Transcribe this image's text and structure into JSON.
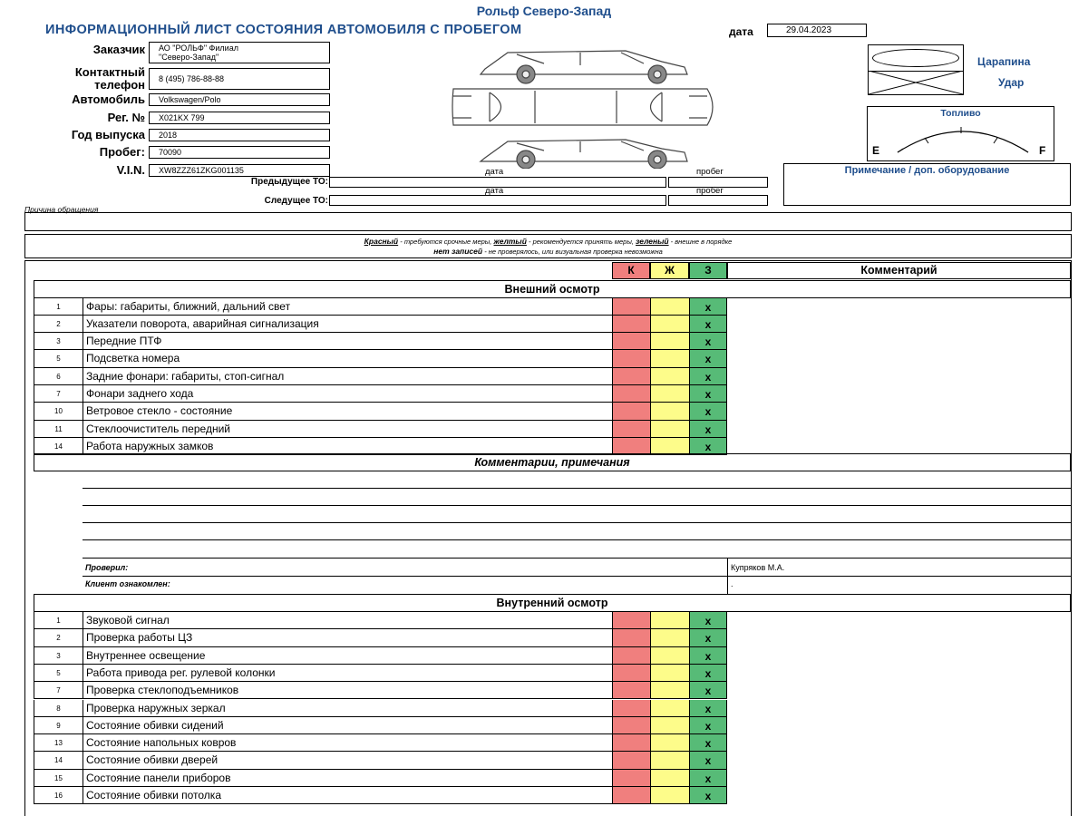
{
  "header": {
    "company": "Рольф Северо-Запад",
    "title": "ИНФОРМАЦИОННЫЙ ЛИСТ СОСТОЯНИЯ АВТОМОБИЛЯ С ПРОБЕГОМ",
    "date_label": "дата",
    "date_value": "29.04.2023"
  },
  "fields": {
    "customer_label": "Заказчик",
    "customer_value_line1": "АО \"РОЛЬФ\" Филиал",
    "customer_value_line2": "\"Северо-Запад\"",
    "phone_label_line1": "Контактный",
    "phone_label_line2": "телефон",
    "phone_value": "8 (495) 786-88-88",
    "car_label": "Автомобиль",
    "car_value": "Volkswagen/Polo",
    "reg_label": "Рег. №",
    "reg_value": "X021KX 799",
    "year_label": "Год выпуска",
    "year_value": "2018",
    "mileage_label": "Пробег:",
    "mileage_value": "70090",
    "vin_label": "V.I.N.",
    "vin_value": "XW8ZZZ61ZKG001135"
  },
  "service": {
    "date_col": "дата",
    "mileage_col": "пробег",
    "prev_label": "Предыдущее ТО:",
    "next_label": "Следущее ТО:"
  },
  "legend": {
    "scratch": "Царапина",
    "dent": "Удар",
    "fuel": "Топливо",
    "fuel_empty": "E",
    "fuel_full": "F",
    "notes_title": "Примечание / доп. оборудование"
  },
  "reason_label": "Причина обращения",
  "color_legend": {
    "red": "Красный",
    "red_desc": "- требуются срочные меры,",
    "yellow": "желтый",
    "yellow_desc": "- рекомендуется принять меры,",
    "green": "зеленый",
    "green_desc": "- внешне в порядке",
    "none": "нет записей",
    "none_desc": "- не проверялось, или визуальная проверка невозможна"
  },
  "table_header": {
    "k": "К",
    "zh": "Ж",
    "z": "З",
    "comment": "Комментарий"
  },
  "exterior": {
    "title": "Внешний осмотр",
    "rows": [
      {
        "num": "1",
        "text": "Фары: габариты, ближний, дальний свет",
        "mark": "x"
      },
      {
        "num": "2",
        "text": "Указатели поворота, аварийная сигнализация",
        "mark": "x"
      },
      {
        "num": "3",
        "text": "Передние ПТФ",
        "mark": "x"
      },
      {
        "num": "5",
        "text": "Подсветка номера",
        "mark": "x"
      },
      {
        "num": "6",
        "text": "Задние фонари: габариты, стоп-сигнал",
        "mark": "x"
      },
      {
        "num": "7",
        "text": "Фонари заднего хода",
        "mark": "x"
      },
      {
        "num": "10",
        "text": "Ветровое стекло - состояние",
        "mark": "x"
      },
      {
        "num": "11",
        "text": "Стеклоочиститель передний",
        "mark": "x"
      },
      {
        "num": "14",
        "text": "Работа наружных замков",
        "mark": "x"
      }
    ]
  },
  "comments": {
    "title": "Комментарии, примечания",
    "checked_label": "Проверил:",
    "checked_value": "Купряков М.А.",
    "client_label": "Клиент ознакомлен:",
    "client_value": "."
  },
  "interior": {
    "title": "Внутренний осмотр",
    "rows": [
      {
        "num": "1",
        "text": "Звуковой сигнал",
        "mark": "x"
      },
      {
        "num": "2",
        "text": "Проверка работы ЦЗ",
        "mark": "x"
      },
      {
        "num": "3",
        "text": "Внутреннее освещение",
        "mark": "x"
      },
      {
        "num": "5",
        "text": "Работа привода рег. рулевой колонки",
        "mark": "x"
      },
      {
        "num": "7",
        "text": "Проверка стеклоподъемников",
        "mark": "x"
      },
      {
        "num": "8",
        "text": "Проверка наружных зеркал",
        "mark": "x"
      },
      {
        "num": "9",
        "text": "Состояние обивки сидений",
        "mark": "x"
      },
      {
        "num": "13",
        "text": "Состояние напольных ковров",
        "mark": "x"
      },
      {
        "num": "14",
        "text": "Состояние обивки дверей",
        "mark": "x"
      },
      {
        "num": "15",
        "text": "Состояние панели приборов",
        "mark": "x"
      },
      {
        "num": "16",
        "text": "Состояние обивки потолка",
        "mark": "x"
      }
    ]
  },
  "colors": {
    "title_blue": "#1f4e8c",
    "red": "#f07f7e",
    "yellow": "#fdfc8a",
    "green": "#57bb77"
  }
}
